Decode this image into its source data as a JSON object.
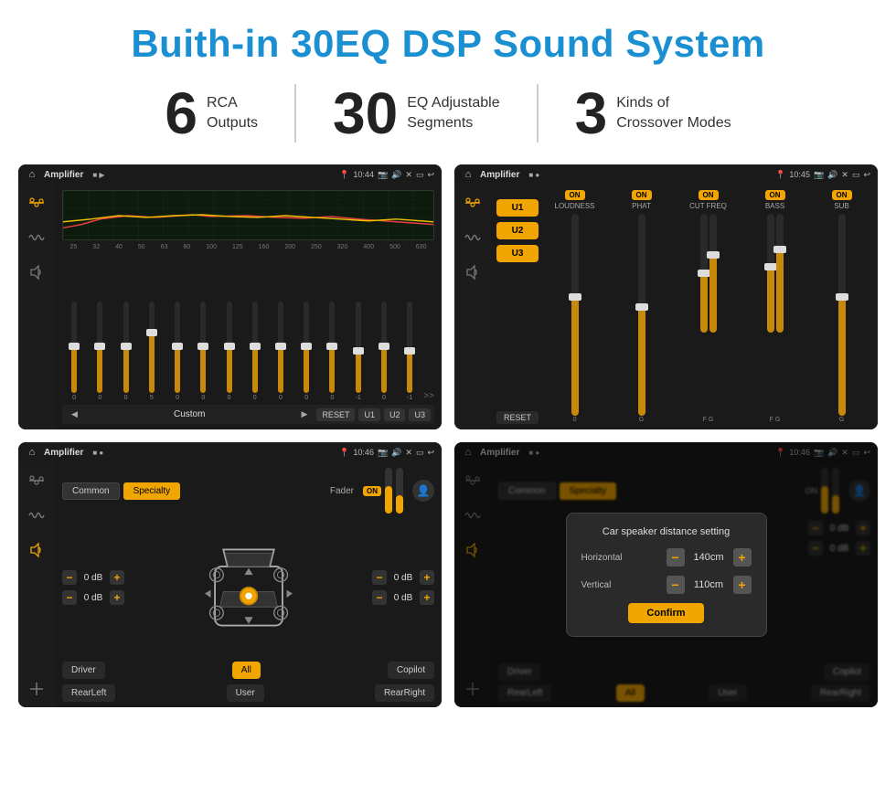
{
  "title": "Buith-in 30EQ DSP Sound System",
  "features": [
    {
      "num": "6",
      "text": "RCA\nOutputs"
    },
    {
      "num": "30",
      "text": "EQ Adjustable\nSegments"
    },
    {
      "num": "3",
      "text": "Kinds of\nCrossover Modes"
    }
  ],
  "screens": {
    "eq": {
      "topbar": {
        "title": "Amplifier",
        "time": "10:44"
      },
      "freqs": [
        "25",
        "32",
        "40",
        "50",
        "63",
        "80",
        "100",
        "125",
        "160",
        "200",
        "250",
        "320",
        "400",
        "500",
        "630"
      ],
      "vals": [
        "0",
        "0",
        "0",
        "5",
        "0",
        "0",
        "0",
        "0",
        "0",
        "0",
        "0",
        "-1",
        "0",
        "-1"
      ],
      "preset": "Custom",
      "buttons": [
        "RESET",
        "U1",
        "U2",
        "U3"
      ]
    },
    "crossover": {
      "topbar": {
        "title": "Amplifier",
        "time": "10:45"
      },
      "uButtons": [
        "U1",
        "U2",
        "U3"
      ],
      "channels": [
        {
          "label": "LOUDNESS"
        },
        {
          "label": "PHAT"
        },
        {
          "label": "CUT FREQ"
        },
        {
          "label": "BASS"
        },
        {
          "label": "SUB"
        }
      ],
      "resetLabel": "RESET"
    },
    "fader": {
      "topbar": {
        "title": "Amplifier",
        "time": "10:46"
      },
      "tabs": [
        "Common",
        "Specialty"
      ],
      "activeTab": "Specialty",
      "faderLabel": "Fader",
      "onLabel": "ON",
      "volControls": [
        {
          "val": "0 dB"
        },
        {
          "val": "0 dB"
        }
      ],
      "volControlsRight": [
        {
          "val": "0 dB"
        },
        {
          "val": "0 dB"
        }
      ],
      "bottomBtns": [
        "Driver",
        "",
        "",
        "",
        "",
        "Copilot",
        "RearLeft",
        "All",
        "",
        "User",
        "RearRight"
      ]
    },
    "dialog": {
      "topbar": {
        "title": "Amplifier",
        "time": "10:46"
      },
      "tabs": [
        "Common",
        "Specialty"
      ],
      "dialogTitle": "Car speaker distance setting",
      "horizontal": "140cm",
      "vertical": "110cm",
      "confirmLabel": "Confirm",
      "volRight1": "0 dB",
      "volRight2": "0 dB",
      "bottomBtns": [
        "Driver",
        "Copilot",
        "RearLeft",
        "All",
        "User",
        "RearRight"
      ]
    }
  },
  "icons": {
    "home": "⌂",
    "menu": "≡",
    "location": "📍",
    "camera": "📷",
    "volume": "🔊",
    "close": "✕",
    "back": "↩",
    "eq": "≋",
    "wave": "〜",
    "speaker": "📢",
    "arrow_left": "◀",
    "arrow_right": "▶",
    "arrow_up": "▲",
    "arrow_down": "▼",
    "person": "👤"
  }
}
